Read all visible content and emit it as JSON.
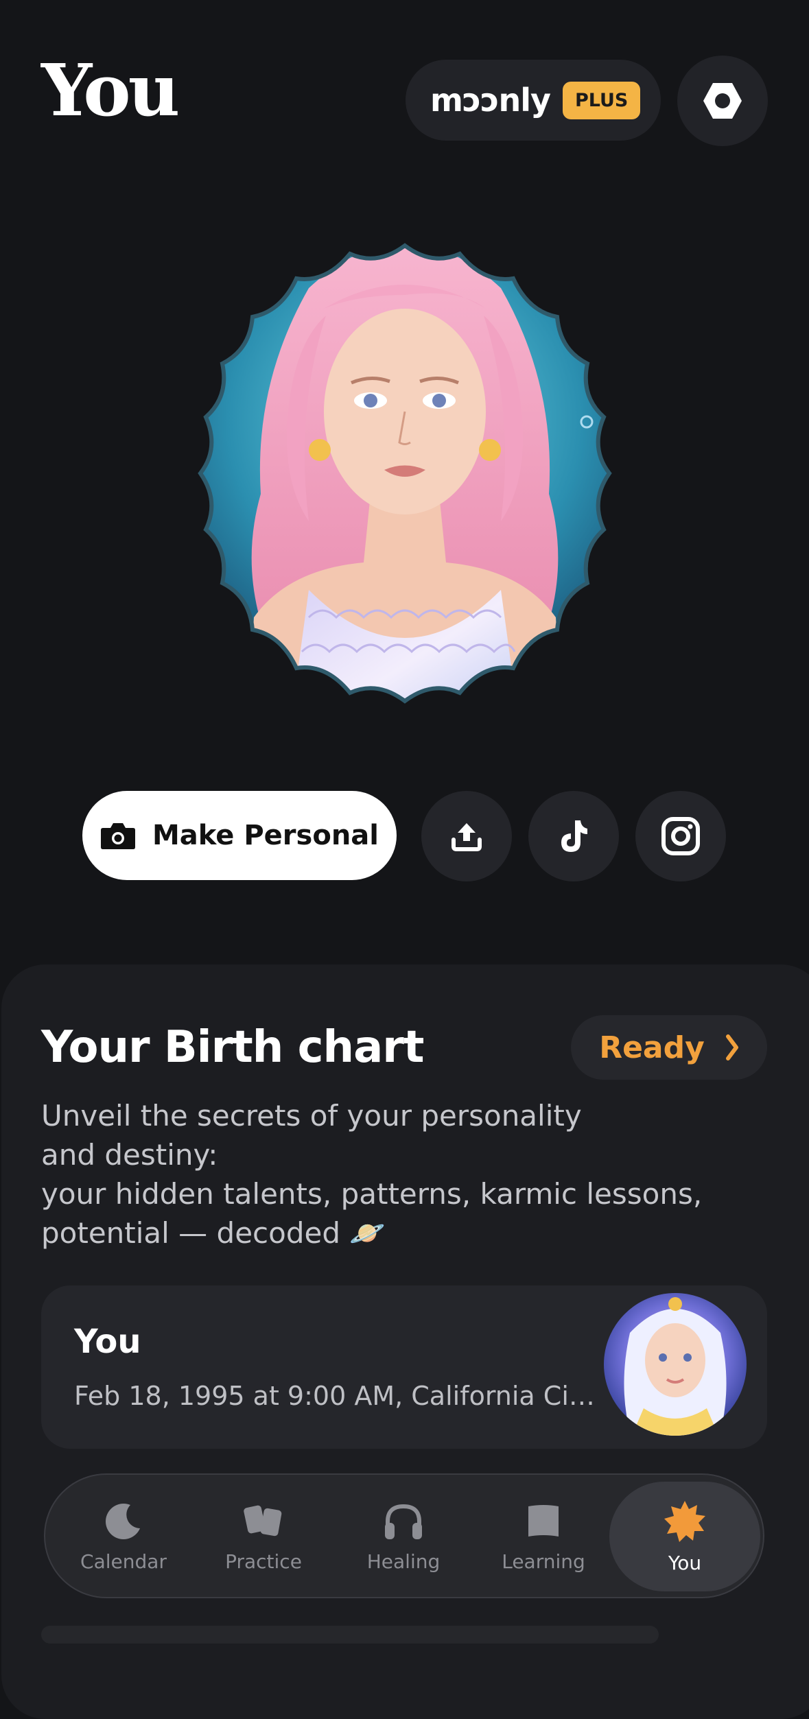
{
  "header": {
    "title": "You",
    "brand": "mɔɔnly",
    "plan_badge": "PLUS"
  },
  "actions": {
    "make_personal_label": "Make Personal"
  },
  "birth_chart": {
    "title": "Your Birth chart",
    "status": "Ready",
    "description_lines": [
      "Unveil the secrets of your personality",
      "and destiny:",
      "your hidden talents, patterns, karmic lessons,",
      "potential — decoded 🪐"
    ],
    "profile": {
      "name": "You",
      "details": "Feb 18, 1995 at 9:00 AM, California City..."
    }
  },
  "nav": {
    "items": [
      {
        "label": "Calendar",
        "icon": "moon-icon"
      },
      {
        "label": "Practice",
        "icon": "cards-icon"
      },
      {
        "label": "Healing",
        "icon": "headphones-icon"
      },
      {
        "label": "Learning",
        "icon": "book-icon"
      },
      {
        "label": "You",
        "icon": "sun-icon",
        "active": true
      }
    ]
  },
  "colors": {
    "background": "#141518",
    "accent_orange": "#f2a13d",
    "plus_badge": "#f4b445"
  }
}
